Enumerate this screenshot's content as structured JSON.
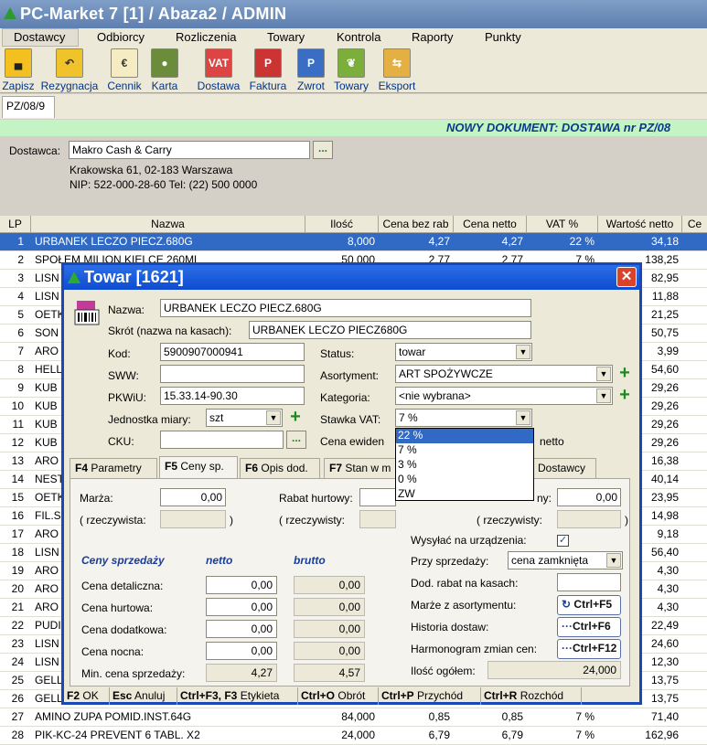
{
  "window": {
    "title": "PC-Market 7 [1] / Abaza2 / ADMIN"
  },
  "menu": [
    "Dostawcy",
    "Odbiorcy",
    "Rozliczenia",
    "Towary",
    "Kontrola",
    "Raporty",
    "Punkty"
  ],
  "toolbar": [
    {
      "label": "Zapisz",
      "icon": "floppy-icon"
    },
    {
      "label": "Rezygnacja",
      "icon": "undo-arrow-icon"
    },
    {
      "label": "Cennik",
      "icon": "price-list-icon"
    },
    {
      "label": "Karta",
      "icon": "card-icon"
    },
    {
      "label": "Dostawa",
      "icon": "truck-vat-icon",
      "badge": "VAT"
    },
    {
      "label": "Faktura",
      "icon": "invoice-vat-icon",
      "badge": "P"
    },
    {
      "label": "Zwrot",
      "icon": "return-icon",
      "badge": "P"
    },
    {
      "label": "Towary",
      "icon": "goods-icon"
    },
    {
      "label": "Eksport",
      "icon": "export-icon"
    }
  ],
  "doc_tab": "PZ/08/9",
  "banner": "NOWY DOKUMENT: DOSTAWA nr PZ/08",
  "supplier": {
    "label": "Dostawca:",
    "name": "Makro Cash & Carry",
    "browse": "...",
    "address": "Krakowska 61, 02-183 Warszawa",
    "nip": "NIP: 522-000-28-60 Tel: (22) 500 0000"
  },
  "grid": {
    "headers": [
      "LP",
      "Nazwa",
      "Ilość",
      "Cena bez rab",
      "Cena netto",
      "VAT %",
      "Wartość netto",
      "Ce"
    ],
    "rows": [
      {
        "lp": "1",
        "name": "URBANEK LECZO PIECZ.680G",
        "qty": "8,000",
        "price": "4,27",
        "net": "4,27",
        "vat": "22 %",
        "value": "34,18",
        "selected": true
      },
      {
        "lp": "2",
        "name": "SPOŁEM MILION KIELCE 260ML",
        "qty": "50,000",
        "price": "2,77",
        "net": "2,77",
        "vat": "7 %",
        "value": "138,25"
      },
      {
        "lp": "3",
        "name": "LISN",
        "value": "82,95"
      },
      {
        "lp": "4",
        "name": "LISN",
        "value": "11,88"
      },
      {
        "lp": "5",
        "name": "OETK",
        "value": "21,25"
      },
      {
        "lp": "6",
        "name": "SON",
        "value": "50,75"
      },
      {
        "lp": "7",
        "name": "ARO",
        "value": "3,99"
      },
      {
        "lp": "8",
        "name": "HELL",
        "value": "54,60"
      },
      {
        "lp": "9",
        "name": "KUB",
        "value": "29,26"
      },
      {
        "lp": "10",
        "name": "KUB",
        "value": "29,26"
      },
      {
        "lp": "11",
        "name": "KUB",
        "value": "29,26"
      },
      {
        "lp": "12",
        "name": "KUB",
        "value": "29,26"
      },
      {
        "lp": "13",
        "name": "ARO",
        "value": "16,38"
      },
      {
        "lp": "14",
        "name": "NEST",
        "value": "40,14"
      },
      {
        "lp": "15",
        "name": "OETK",
        "value": "23,95"
      },
      {
        "lp": "16",
        "name": "FIL.S",
        "value": "14,98"
      },
      {
        "lp": "17",
        "name": "ARO",
        "value": "9,18"
      },
      {
        "lp": "18",
        "name": "LISN",
        "value": "56,40"
      },
      {
        "lp": "19",
        "name": "ARO",
        "value": "4,30"
      },
      {
        "lp": "20",
        "name": "ARO",
        "value": "4,30"
      },
      {
        "lp": "21",
        "name": "ARO",
        "value": "4,30"
      },
      {
        "lp": "22",
        "name": "PUDI",
        "value": "22,49"
      },
      {
        "lp": "23",
        "name": "LISN",
        "value": "24,60"
      },
      {
        "lp": "24",
        "name": "LISN",
        "value": "12,30"
      },
      {
        "lp": "25",
        "name": "GELL",
        "value": "13,75"
      },
      {
        "lp": "26",
        "name": "GELL",
        "value": "13,75"
      },
      {
        "lp": "27",
        "name": "AMINO ZUPA POMID.INST.64G",
        "qty": "84,000",
        "price": "0,85",
        "net": "0,85",
        "vat": "7 %",
        "value": "71,40"
      },
      {
        "lp": "28",
        "name": "PIK-KC-24 PREVENT 6 TABL. X2",
        "qty": "24,000",
        "price": "6,79",
        "net": "6,79",
        "vat": "7 %",
        "value": "162,96"
      }
    ]
  },
  "dialog": {
    "title": "Towar [1621]",
    "close": "✕",
    "nazwa_label": "Nazwa:",
    "nazwa": "URBANEK LECZO PIECZ.680G",
    "skrot_label": "Skrót (nazwa na kasach):",
    "skrot": "URBANEK LECZO PIECZ680G",
    "kod_label": "Kod:",
    "kod": "5900907000941",
    "sww_label": "SWW:",
    "sww": "",
    "pkwiu_label": "PKWiU:",
    "pkwiu": "15.33.14-90.30",
    "jm_label": "Jednostka miary:",
    "jm": "szt",
    "cku_label": "CKU:",
    "cku": "",
    "cku_browse": "...",
    "status_label": "Status:",
    "status": "towar",
    "asort_label": "Asortyment:",
    "asort": "ART SPOŻYWCZE",
    "kat_label": "Kategoria:",
    "kat": "<nie wybrana>",
    "vat_label": "Stawka VAT:",
    "vat": "7 %",
    "cena_ewid_label": "Cena ewiden",
    "cena_ewid_suffix": "netto",
    "plus": "+",
    "vat_options": [
      "22 %",
      "7 %",
      "3 %",
      "0 %",
      "ZW"
    ],
    "tabs": [
      {
        "key": "F4",
        "label": "Parametry"
      },
      {
        "key": "F5",
        "label": "Ceny sp."
      },
      {
        "key": "F6",
        "label": "Opis dod."
      },
      {
        "key": "F7",
        "label": "Stan w m"
      },
      {
        "key": "",
        "label": "Dostawcy"
      }
    ],
    "prices": {
      "marza_label": "Marża:",
      "marza": "0,00",
      "rzecz_label": "( rzeczywista:",
      "close_paren": ")",
      "rabat_label": "Rabat hurtowy:",
      "rzeczy_label": "( rzeczywisty:",
      "ny_label": "ny:",
      "ny_value": "0,00",
      "rzecz2_label": "( rzeczywisty:",
      "ceny_header": "Ceny sprzedaży",
      "netto_header": "netto",
      "brutto_header": "brutto",
      "rows": [
        {
          "label": "Cena detaliczna:",
          "netto": "0,00",
          "brutto": "0,00"
        },
        {
          "label": "Cena hurtowa:",
          "netto": "0,00",
          "brutto": "0,00"
        },
        {
          "label": "Cena dodatkowa:",
          "netto": "0,00",
          "brutto": "0,00"
        },
        {
          "label": "Cena nocna:",
          "netto": "0,00",
          "brutto": "0,00"
        },
        {
          "label": "Min. cena sprzedaży:",
          "netto": "4,27",
          "brutto": "4,57"
        }
      ],
      "wysylac_label": "Wysyłać na urządzenia:",
      "wysylac_checked": "✓",
      "przy_label": "Przy sprzedaży:",
      "przy": "cena zamknięta",
      "dod_rabat_label": "Dod. rabat na kasach:",
      "marze_label": "Marże z asortymentu:",
      "marze_btn": "Ctrl+F5",
      "historia_label": "Historia dostaw:",
      "historia_btn": "Ctrl+F6",
      "harmonogram_label": "Harmonogram zmian cen:",
      "harmonogram_btn": "Ctrl+F12",
      "ilosc_label": "Ilość ogółem:",
      "ilosc": "24,000"
    },
    "fkeys": [
      {
        "key": "F2",
        "label": "OK"
      },
      {
        "key": "Esc",
        "label": "Anuluj"
      },
      {
        "key": "Ctrl+F3, F3",
        "label": "Etykieta"
      },
      {
        "key": "Ctrl+O",
        "label": "Obrót"
      },
      {
        "key": "Ctrl+P",
        "label": "Przychód"
      },
      {
        "key": "Ctrl+R",
        "label": "Rozchód"
      }
    ]
  }
}
